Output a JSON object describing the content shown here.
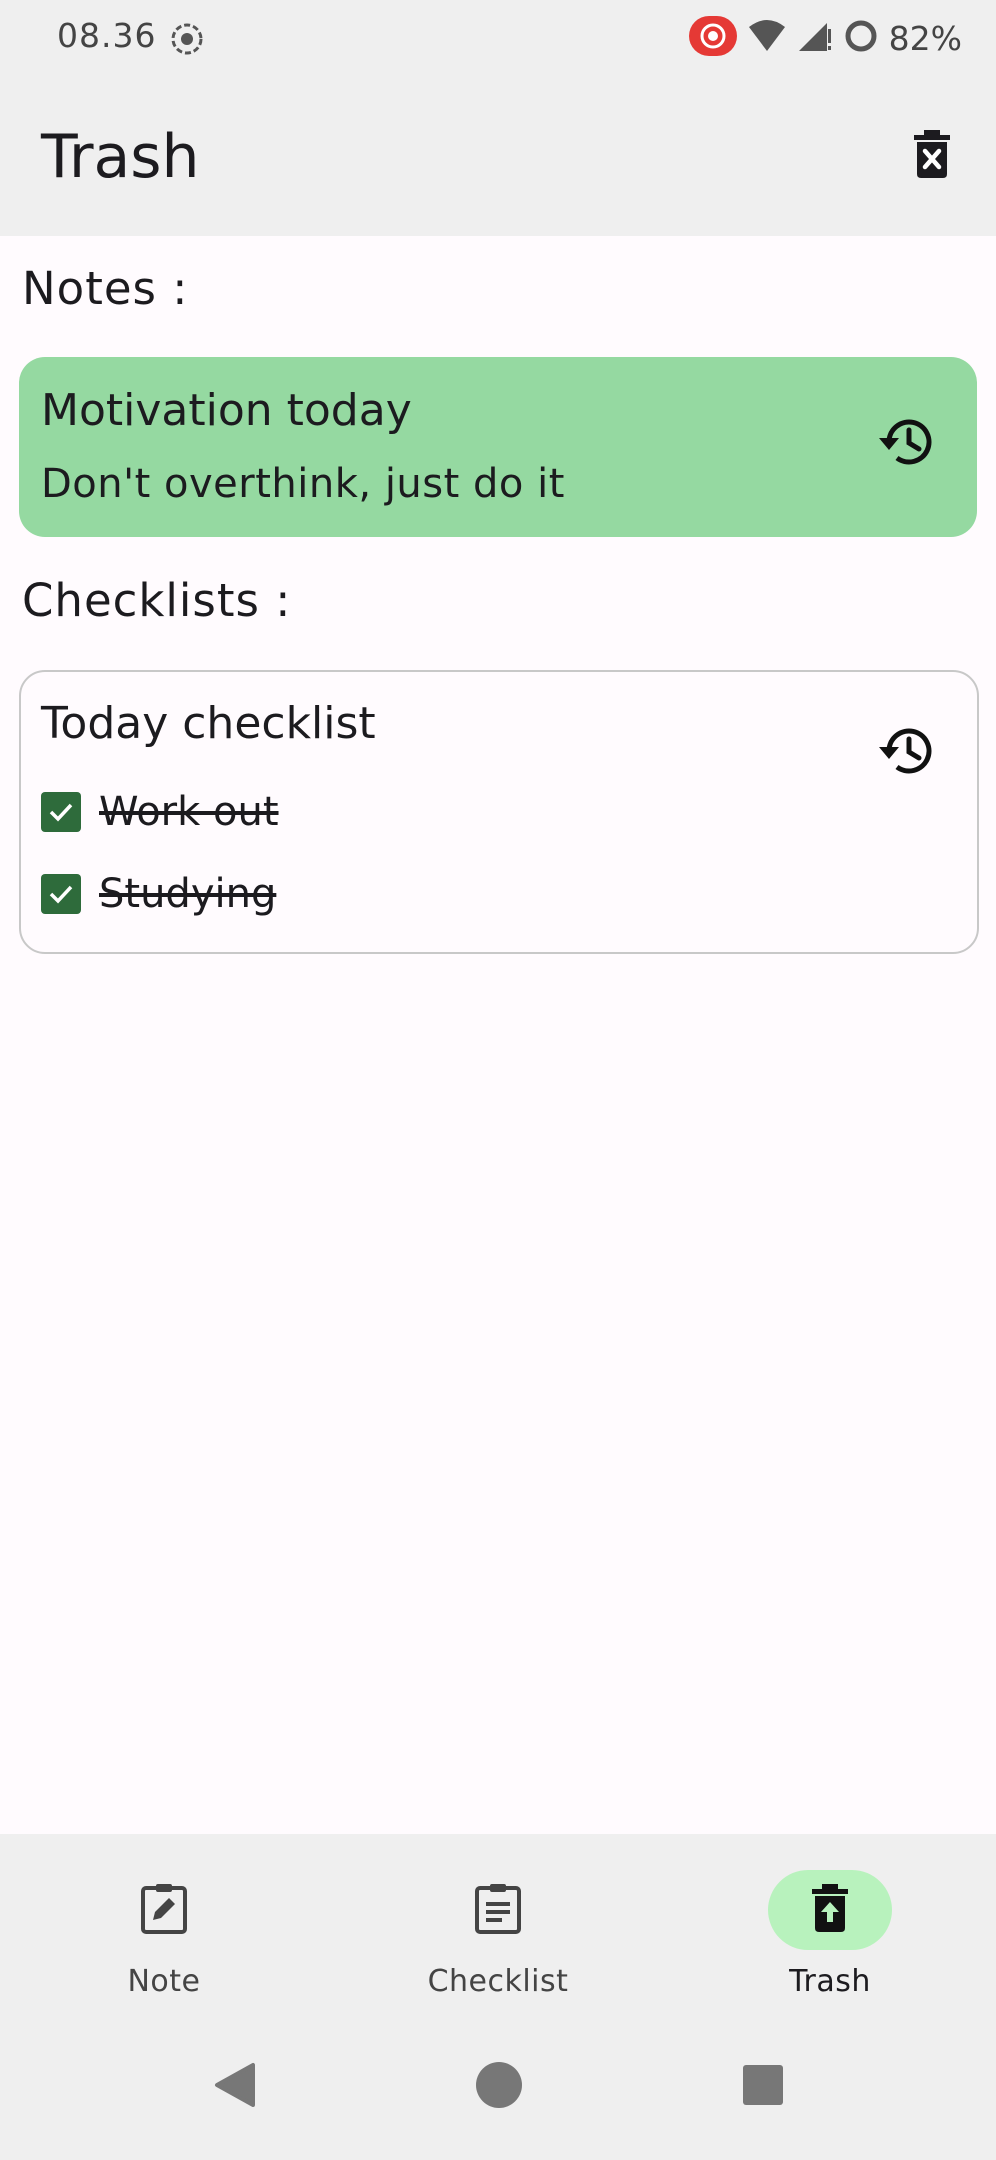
{
  "status_bar": {
    "time": "08.36",
    "battery": "82%",
    "icons": [
      "record-icon",
      "screen-record-icon",
      "wifi-icon",
      "signal-icon",
      "battery-ring-icon"
    ]
  },
  "app_bar": {
    "title": "Trash",
    "action_icon": "delete-forever-icon"
  },
  "notes_section": {
    "heading": "Notes :",
    "items": [
      {
        "title": "Motivation today",
        "body": "Don't overthink, just do it",
        "color": "#95d9a1",
        "action_icon": "restore-icon"
      }
    ]
  },
  "checklists_section": {
    "heading": "Checklists :",
    "items": [
      {
        "title": "Today checklist",
        "action_icon": "restore-icon",
        "entries": [
          {
            "label": "Work out",
            "checked": true
          },
          {
            "label": "Studying",
            "checked": true
          }
        ]
      }
    ]
  },
  "bottom_nav": {
    "items": [
      {
        "label": "Note",
        "icon": "edit-note-icon",
        "active": false
      },
      {
        "label": "Checklist",
        "icon": "clipboard-icon",
        "active": false
      },
      {
        "label": "Trash",
        "icon": "trash-restore-icon",
        "active": true
      }
    ],
    "active_color": "#b8f2bd"
  },
  "system_nav": {
    "buttons": [
      "back-icon",
      "home-icon",
      "recents-icon"
    ]
  },
  "colors": {
    "checkbox": "#2e6b3b",
    "background": "#fffbfe",
    "bars": "#efefef"
  }
}
